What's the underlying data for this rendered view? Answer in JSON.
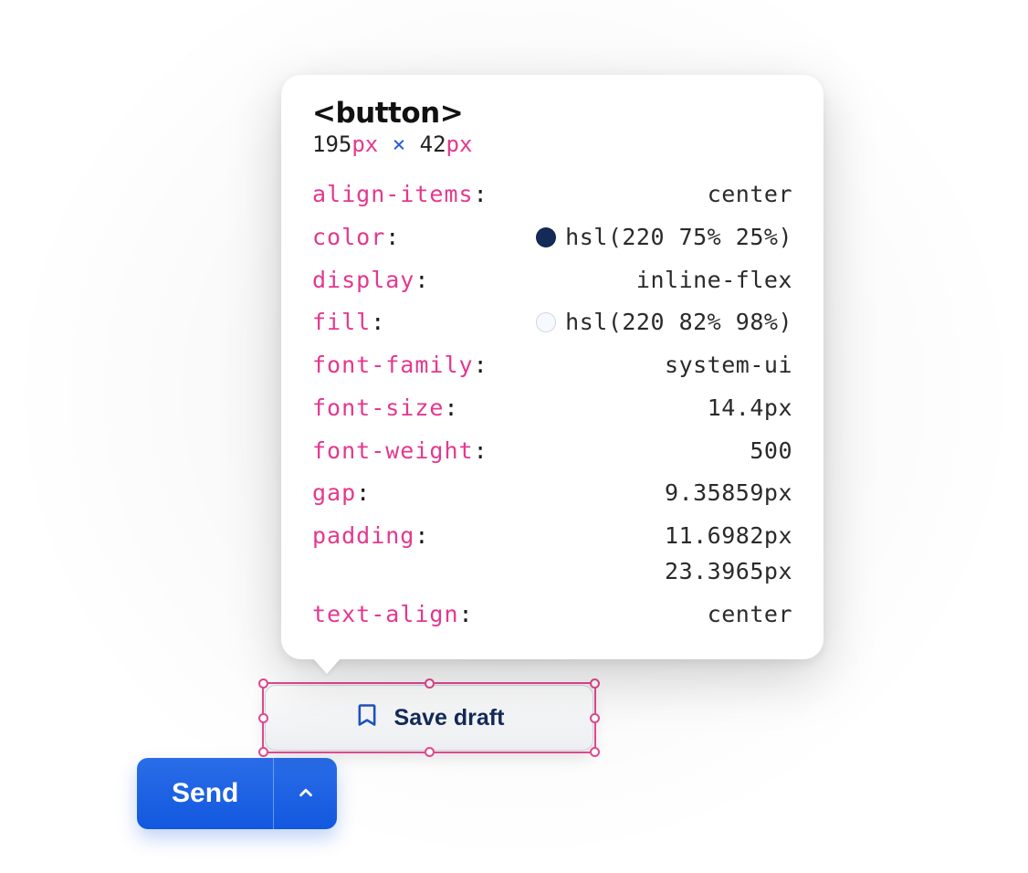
{
  "inspector": {
    "tag": "<button>",
    "width_num": "195",
    "height_num": "42",
    "unit": "px",
    "cross": "×",
    "props": [
      {
        "name": "align-items",
        "value": "center"
      },
      {
        "name": "color",
        "value": "hsl(220 75% 25%)",
        "swatch": "#142b57"
      },
      {
        "name": "display",
        "value": "inline-flex"
      },
      {
        "name": "fill",
        "value": "hsl(220 82% 98%)",
        "swatch": "#f6f9fe"
      },
      {
        "name": "font-family",
        "value": "system-ui"
      },
      {
        "name": "font-size",
        "value": "14.4px"
      },
      {
        "name": "font-weight",
        "value": "500"
      },
      {
        "name": "gap",
        "value": "9.35859px"
      },
      {
        "name": "padding",
        "value": "11.6982px\n23.3965px"
      },
      {
        "name": "text-align",
        "value": "center"
      }
    ]
  },
  "buttons": {
    "secondary_label": "Save draft",
    "secondary_icon_name": "bookmark-icon",
    "primary_label": "Send",
    "split_icon_name": "chevron-up-icon"
  }
}
